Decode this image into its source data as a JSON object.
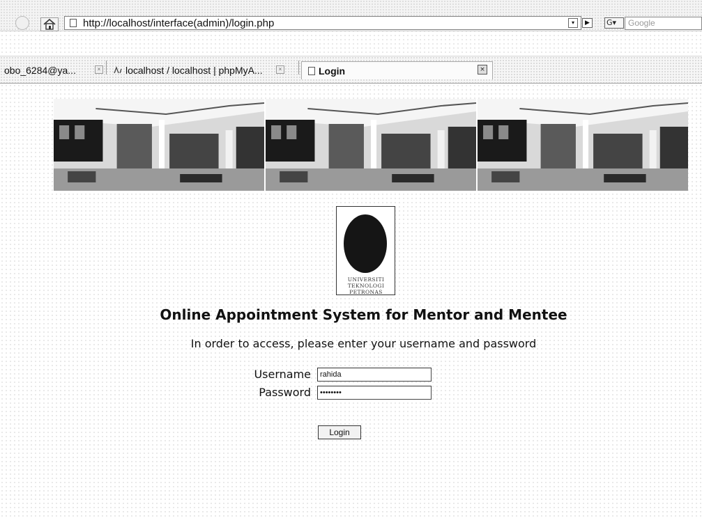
{
  "browser": {
    "url": "http://localhost/interface(admin)/login.php",
    "search_placeholder": "Google",
    "go_glyph": "▶",
    "dropdown_glyph": "▾",
    "engine_glyph": "G▾"
  },
  "tabs": [
    {
      "label": "obo_6284@ya..."
    },
    {
      "label": "localhost / localhost | phpMyA..."
    },
    {
      "label": "Login",
      "active": true
    }
  ],
  "logo": {
    "lines": [
      "UNIVERSITI",
      "TEKNOLOGI",
      "PETRONAS"
    ]
  },
  "page": {
    "title": "Online Appointment System for Mentor and Mentee",
    "instructions": "In order to access, please enter your username and password"
  },
  "form": {
    "username_label": "Username",
    "username_value": "rahida",
    "password_label": "Password",
    "password_value": "********",
    "login_label": "Login"
  }
}
